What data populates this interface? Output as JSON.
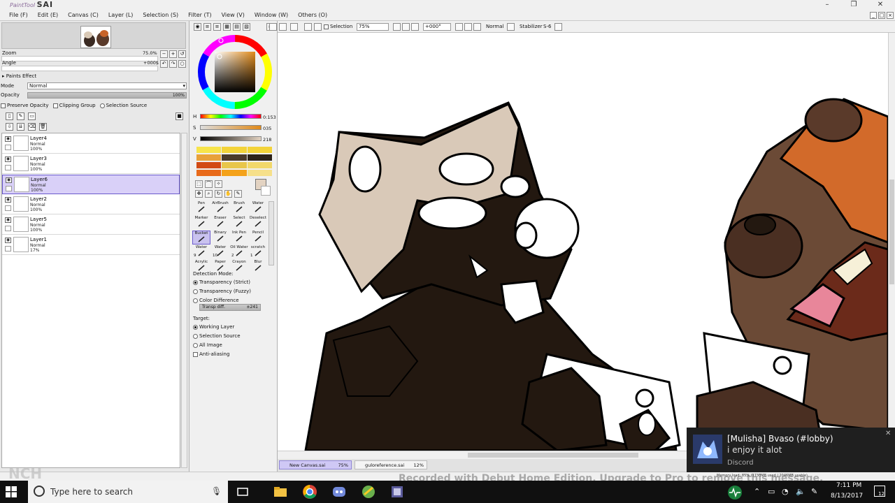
{
  "app": {
    "logo_small": "PaintTool",
    "logo_big": "SAI",
    "menu": [
      "File (F)",
      "Edit (E)",
      "Canvas (C)",
      "Layer (L)",
      "Selection (S)",
      "Filter (T)",
      "View (V)",
      "Window (W)",
      "Others (O)"
    ]
  },
  "navigator": {
    "zoom_label": "Zoom",
    "zoom_value": "75.0%",
    "angle_label": "Angle",
    "angle_value": "+000$"
  },
  "paints_effect": {
    "title": "Paints Effect",
    "mode_label": "Mode",
    "mode_value": "Normal",
    "opacity_label": "Opacity",
    "opacity_value": "100%",
    "preserve_opacity": "Preserve Opacity",
    "clipping_group": "Clipping Group",
    "selection_source": "Selection Source"
  },
  "layers": [
    {
      "name": "Layer4",
      "mode": "Normal",
      "opacity": "100%",
      "selected": false
    },
    {
      "name": "Layer3",
      "mode": "Normal",
      "opacity": "100%",
      "selected": false
    },
    {
      "name": "Layer6",
      "mode": "Normal",
      "opacity": "100%",
      "selected": true
    },
    {
      "name": "Layer2",
      "mode": "Normal",
      "opacity": "100%",
      "selected": false
    },
    {
      "name": "Layer5",
      "mode": "Normal",
      "opacity": "100%",
      "selected": false
    },
    {
      "name": "Layer1",
      "mode": "Normal",
      "opacity": "17%",
      "selected": false
    }
  ],
  "color": {
    "h_label": "H",
    "h_value": "0:153",
    "s_label": "S",
    "s_value": "035",
    "v_label": "V",
    "v_value": "218",
    "current": "#e3d3c2"
  },
  "tools": [
    {
      "name": "Pen"
    },
    {
      "name": "AirBrush"
    },
    {
      "name": "Brush"
    },
    {
      "name": "Water"
    },
    {
      "name": "Marker"
    },
    {
      "name": "Eraser"
    },
    {
      "name": "Select"
    },
    {
      "name": "Deselect"
    },
    {
      "name": "Bucket"
    },
    {
      "name": "Binary"
    },
    {
      "name": "Ink Pen"
    },
    {
      "name": "Pencil"
    },
    {
      "name": "Water"
    },
    {
      "name": "Water"
    },
    {
      "name": "Oil Water"
    },
    {
      "name": "scratch"
    },
    {
      "name": "Acrylic"
    },
    {
      "name": "Paper"
    },
    {
      "name": "Crayon"
    },
    {
      "name": "Blur"
    }
  ],
  "tool_sizes": [
    "9",
    "10",
    "2",
    "1"
  ],
  "detection": {
    "title": "Detection Mode:",
    "options": [
      "Transparency (Strict)",
      "Transparency (Fuzzy)",
      "Color Difference"
    ],
    "slider_label": "Transp diff.",
    "slider_value": "±241",
    "target_title": "Target:",
    "targets": [
      "Working Layer",
      "Selection Source",
      "All Image"
    ],
    "anti_aliasing": "Anti-aliasing"
  },
  "toolbar": {
    "selection_label": "Selection",
    "zoom": "75%",
    "angle": "+000°",
    "blend": "Normal",
    "stabilizer_label": "Stabilizer",
    "stabilizer_value": "S-6"
  },
  "doc_tabs": [
    {
      "name": "New Canvas.sai",
      "zoom": "75%",
      "active": true
    },
    {
      "name": "guloreference.sai",
      "zoom": "12%",
      "active": false
    }
  ],
  "status": {
    "watermark": "Recorded with Debut Home Edition. Upgrade to Pro to remove this message.",
    "memory": "Memory load: 85% (1730MB used / 2046MB usable)",
    "nch": "NCH"
  },
  "taskbar": {
    "search_placeholder": "Type here to search",
    "time": "7:11 PM",
    "date": "8/13/2017",
    "notif_count": "12"
  },
  "notification": {
    "title": "[Mulisha] Bvaso (#lobby)",
    "body": "i enjoy it alot",
    "app": "Discord"
  }
}
